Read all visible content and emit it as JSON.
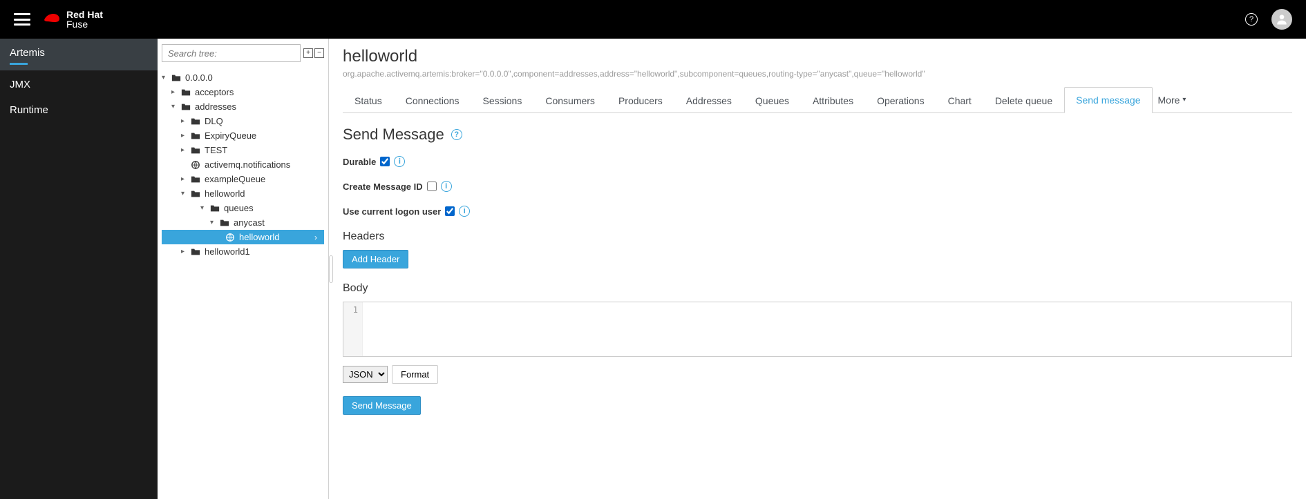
{
  "brand": {
    "primary": "Red Hat",
    "secondary": "Fuse"
  },
  "nav": {
    "items": [
      "Artemis",
      "JMX",
      "Runtime"
    ],
    "activeIndex": 0
  },
  "tree": {
    "searchPlaceholder": "Search tree:",
    "nodes": {
      "root": "0.0.0.0",
      "acceptors": "acceptors",
      "addresses": "addresses",
      "dlq": "DLQ",
      "expiry": "ExpiryQueue",
      "test": "TEST",
      "amqnotif": "activemq.notifications",
      "exampleQueue": "exampleQueue",
      "helloworld": "helloworld",
      "queues": "queues",
      "anycast": "anycast",
      "helloworldLeaf": "helloworld",
      "helloworld1": "helloworld1"
    }
  },
  "page": {
    "title": "helloworld",
    "subtitle": "org.apache.activemq.artemis:broker=\"0.0.0.0\",component=addresses,address=\"helloworld\",subcomponent=queues,routing-type=\"anycast\",queue=\"helloworld\""
  },
  "tabs": {
    "items": [
      "Status",
      "Connections",
      "Sessions",
      "Consumers",
      "Producers",
      "Addresses",
      "Queues",
      "Attributes",
      "Operations",
      "Chart",
      "Delete queue",
      "Send message"
    ],
    "activeIndex": 11,
    "more": "More"
  },
  "sendMessage": {
    "heading": "Send Message",
    "durableLabel": "Durable",
    "durableChecked": true,
    "createMsgIdLabel": "Create Message ID",
    "createMsgIdChecked": false,
    "useCurrentUserLabel": "Use current logon user",
    "useCurrentUserChecked": true,
    "headersHeading": "Headers",
    "addHeaderBtn": "Add Header",
    "bodyHeading": "Body",
    "editorLine": "1",
    "formatSelect": "JSON",
    "formatBtn": "Format",
    "sendBtn": "Send Message"
  }
}
